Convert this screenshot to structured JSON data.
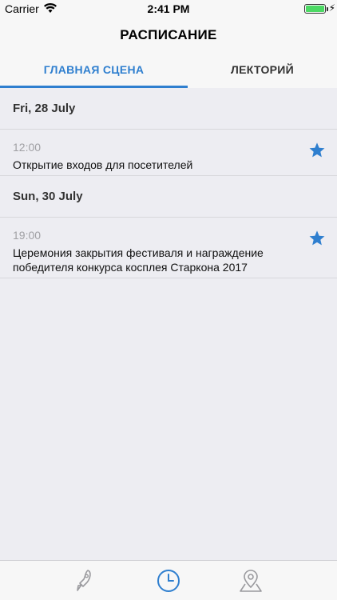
{
  "status_bar": {
    "carrier": "Carrier",
    "time": "2:41 PM"
  },
  "header": {
    "title": "РАСПИСАНИЕ"
  },
  "tabs": [
    {
      "label": "ГЛАВНАЯ СЦЕНА",
      "active": true
    },
    {
      "label": "ЛЕКТОРИЙ",
      "active": false
    }
  ],
  "schedule": [
    {
      "date": "Fri, 28 July",
      "events": [
        {
          "time": "12:00",
          "title": "Открытие входов для посетителей",
          "starred": true
        }
      ]
    },
    {
      "date": "Sun, 30 July",
      "events": [
        {
          "time": "19:00",
          "title": "Церемония закрытия фестиваля и награждение победителя конкурса косплея Старкона 2017",
          "starred": true
        }
      ]
    }
  ],
  "bottom_nav": [
    {
      "icon": "rocket-icon",
      "active": false
    },
    {
      "icon": "clock-icon",
      "active": true
    },
    {
      "icon": "map-pin-icon",
      "active": false
    }
  ],
  "colors": {
    "accent": "#2f7fcf",
    "background": "#ededf2",
    "inactive_icon": "#9a9a9e"
  }
}
